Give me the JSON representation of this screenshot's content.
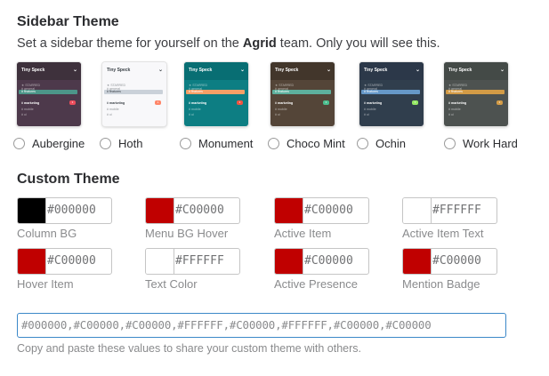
{
  "sidebar_theme": {
    "title": "Sidebar Theme",
    "description_before": "Set a sidebar theme for yourself on the ",
    "team": "Agrid",
    "description_after": " team. Only you will see this.",
    "themes": [
      {
        "label": "Aubergine",
        "bg": "#4d394b",
        "head": "#3e313c",
        "active": "#4c9689",
        "text": "#ffffff",
        "badge": "#eb4d5c",
        "selected": false
      },
      {
        "label": "Hoth",
        "bg": "#f8f8fa",
        "head": "#f8f8fa",
        "active": "#cad1d9",
        "text": "#383f45",
        "badge": "#ff8669",
        "selected": false
      },
      {
        "label": "Monument",
        "bg": "#0d7e83",
        "head": "#086e73",
        "active": "#f79f66",
        "text": "#ffffff",
        "badge": "#f15340",
        "selected": false
      },
      {
        "label": "Choco Mint",
        "bg": "#544538",
        "head": "#42362b",
        "active": "#5db09d",
        "text": "#ffffff",
        "badge": "#4bbe8e",
        "selected": false
      },
      {
        "label": "Ochin",
        "bg": "#303e4d",
        "head": "#2c3849",
        "active": "#6698c8",
        "text": "#ffffff",
        "badge": "#94e864",
        "selected": false
      },
      {
        "label": "Work Hard",
        "bg": "#4d5250",
        "head": "#444a47",
        "active": "#d39b46",
        "text": "#ffffff",
        "badge": "#d39b46",
        "selected": false
      }
    ],
    "thumb": {
      "team_name": "Tiny Speck",
      "starred": "★ STARRED",
      "general": "# general",
      "features": "# features",
      "marketing": "# marketing",
      "marketing_badge": "1",
      "mobile": "# mobile",
      "ui": "# ui"
    }
  },
  "custom_theme": {
    "title": "Custom Theme",
    "swatches": [
      {
        "label": "Column BG",
        "hex": "#000000",
        "color": "#000000"
      },
      {
        "label": "Menu BG Hover",
        "hex": "#C00000",
        "color": "#c00000"
      },
      {
        "label": "Active Item",
        "hex": "#C00000",
        "color": "#c00000"
      },
      {
        "label": "Active Item Text",
        "hex": "#FFFFFF",
        "color": "#ffffff"
      },
      {
        "label": "Hover Item",
        "hex": "#C00000",
        "color": "#c00000"
      },
      {
        "label": "Text Color",
        "hex": "#FFFFFF",
        "color": "#ffffff"
      },
      {
        "label": "Active Presence",
        "hex": "#C00000",
        "color": "#c00000"
      },
      {
        "label": "Mention Badge",
        "hex": "#C00000",
        "color": "#c00000"
      }
    ],
    "theme_string": "#000000,#C00000,#C00000,#FFFFFF,#C00000,#FFFFFF,#C00000,#C00000",
    "helper_text": "Copy and paste these values to share your custom theme with others."
  }
}
